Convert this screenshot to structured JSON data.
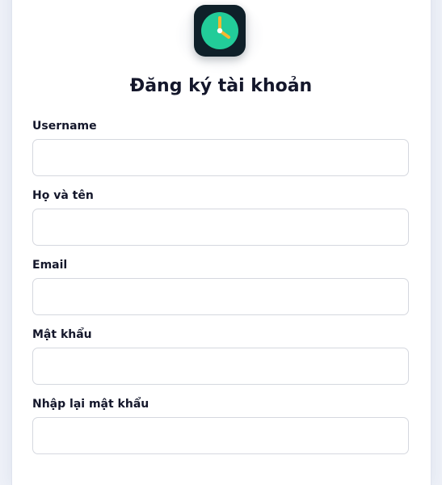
{
  "brand": {
    "logo_icon": "clock-icon",
    "logo_bg": "#0f2029",
    "clock_face": "#22cc99",
    "clock_hand_hour": "#ffffff",
    "clock_hand_minute": "#f5b731"
  },
  "form": {
    "title": "Đăng ký tài khoản",
    "fields": [
      {
        "label": "Username",
        "value": "",
        "placeholder": ""
      },
      {
        "label": "Họ và tên",
        "value": "",
        "placeholder": ""
      },
      {
        "label": "Email",
        "value": "",
        "placeholder": ""
      },
      {
        "label": "Mật khẩu",
        "value": "",
        "placeholder": ""
      },
      {
        "label": "Nhập lại mật khẩu",
        "value": "",
        "placeholder": ""
      }
    ]
  }
}
